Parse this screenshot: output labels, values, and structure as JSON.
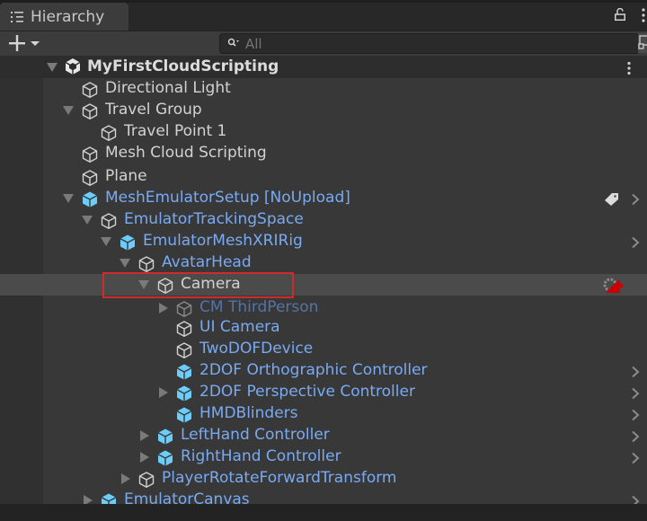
{
  "window": {
    "tab_label": "Hierarchy",
    "tab_icon": "list-icon",
    "lock_icon": "unlocked-padlock-icon",
    "menu_icon": "kebab-menu-icon"
  },
  "toolbar": {
    "add_icon": "plus-icon",
    "add_dropdown_icon": "chevron-down-icon",
    "search_placeholder": "All",
    "search_value": "",
    "search_icon": "search-filter-icon",
    "scene_visibility_icon": "scene-visibility-icon"
  },
  "scene": {
    "name": "MyFirstCloudScripting",
    "icon": "unity-scene-icon",
    "expanded": true
  },
  "hierarchy": [
    {
      "label": "Directional Light",
      "depth": 1,
      "arrow": "none",
      "icon": "gameobject-cube",
      "style": "plain"
    },
    {
      "label": "Travel Group",
      "depth": 1,
      "arrow": "down",
      "icon": "gameobject-cube",
      "style": "plain"
    },
    {
      "label": "Travel Point 1",
      "depth": 2,
      "arrow": "none",
      "icon": "gameobject-cube",
      "style": "plain"
    },
    {
      "label": "Mesh Cloud Scripting",
      "depth": 1,
      "arrow": "none",
      "icon": "gameobject-cube",
      "style": "plain"
    },
    {
      "label": "Plane",
      "depth": 1,
      "arrow": "none",
      "icon": "gameobject-cube",
      "style": "plain"
    },
    {
      "label": "MeshEmulatorSetup [NoUpload]",
      "depth": 1,
      "arrow": "down",
      "icon": "prefab-cube",
      "style": "prefab",
      "tag_icon": true,
      "chevron": true
    },
    {
      "label": "EmulatorTrackingSpace",
      "depth": 2,
      "arrow": "down",
      "icon": "gameobject-cube",
      "style": "prefab"
    },
    {
      "label": "EmulatorMeshXRIRig",
      "depth": 3,
      "arrow": "down",
      "icon": "prefab-cube",
      "style": "prefab",
      "chevron": true
    },
    {
      "label": "AvatarHead",
      "depth": 4,
      "arrow": "down",
      "icon": "gameobject-cube",
      "style": "prefab"
    },
    {
      "label": "Camera",
      "depth": 5,
      "arrow": "down",
      "icon": "gameobject-cube",
      "style": "plain",
      "selected": true,
      "camera_icon": true
    },
    {
      "label": "CM ThirdPerson",
      "depth": 6,
      "arrow": "right",
      "icon": "gameobject-cube-dim",
      "style": "prefab-dim"
    },
    {
      "label": "UI Camera",
      "depth": 6,
      "arrow": "none",
      "icon": "gameobject-cube",
      "style": "prefab"
    },
    {
      "label": "TwoDOFDevice",
      "depth": 6,
      "arrow": "none",
      "icon": "gameobject-cube",
      "style": "prefab"
    },
    {
      "label": "2DOF Orthographic Controller",
      "depth": 6,
      "arrow": "none",
      "icon": "prefab-cube",
      "style": "prefab",
      "chevron": true
    },
    {
      "label": "2DOF Perspective Controller",
      "depth": 6,
      "arrow": "right",
      "icon": "prefab-cube",
      "style": "prefab",
      "chevron": true
    },
    {
      "label": "HMDBlinders",
      "depth": 6,
      "arrow": "none",
      "icon": "prefab-cube",
      "style": "prefab",
      "chevron": true
    },
    {
      "label": "LeftHand Controller",
      "depth": 5,
      "arrow": "right",
      "icon": "prefab-cube",
      "style": "prefab",
      "chevron": true
    },
    {
      "label": "RightHand Controller",
      "depth": 5,
      "arrow": "right",
      "icon": "prefab-cube",
      "style": "prefab",
      "chevron": true
    },
    {
      "label": "PlayerRotateForwardTransform",
      "depth": 4,
      "arrow": "right",
      "icon": "gameobject-cube",
      "style": "prefab"
    },
    {
      "label": "EmulatorCanvas",
      "depth": 2,
      "arrow": "right",
      "icon": "prefab-cube",
      "style": "prefab",
      "chevron": true
    }
  ],
  "highlight": {
    "label": "selection-highlight-box",
    "color": "#d12a2a"
  },
  "colors": {
    "prefab_text": "#79aaf2",
    "prefab_icon": "#6ccdfa",
    "selected_row": "#4b4b4b",
    "background": "#383838"
  }
}
